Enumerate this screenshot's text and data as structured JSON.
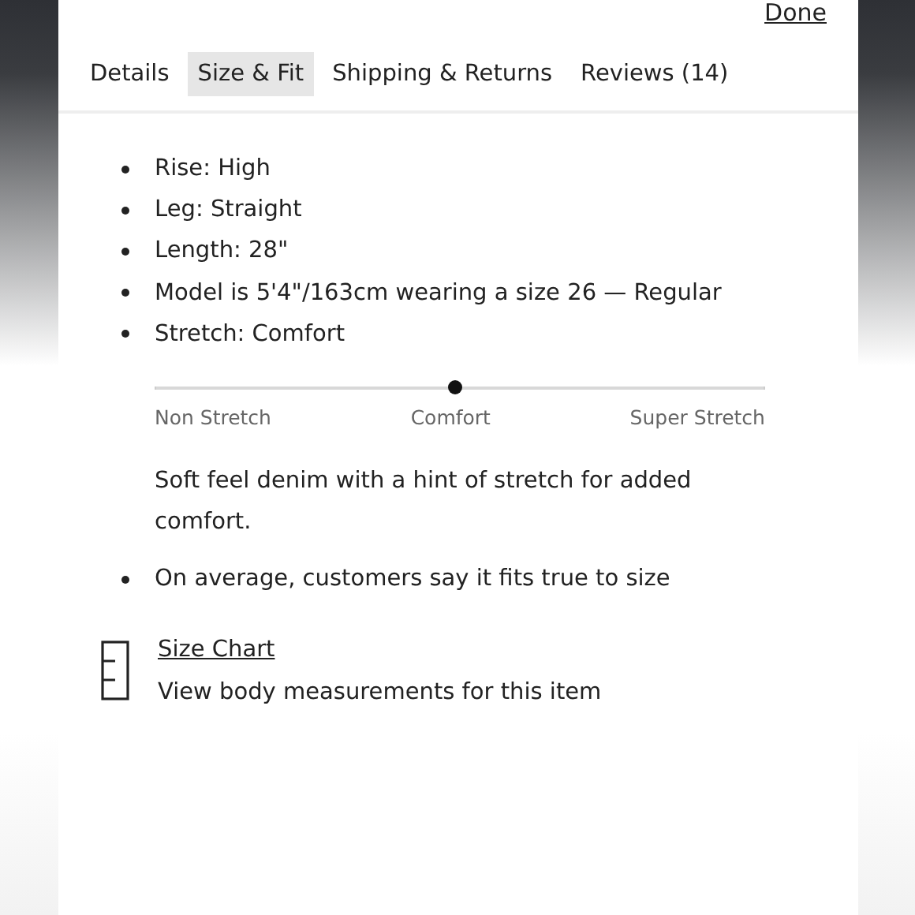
{
  "done_link": "Done",
  "tabs": [
    {
      "label": "Details",
      "selected": false
    },
    {
      "label": "Size & Fit",
      "selected": true
    },
    {
      "label": "Shipping & Returns",
      "selected": false
    },
    {
      "label": "Reviews (14)",
      "selected": false
    }
  ],
  "fit_details": [
    "Rise: High",
    "Leg: Straight",
    "Length: 28\"",
    "Model is 5'4\"/163cm wearing a size 26  —  Regular",
    "Stretch: Comfort"
  ],
  "stretch_scale": {
    "level": 0.49,
    "labels": [
      "Non Stretch",
      "Comfort",
      "Super Stretch"
    ]
  },
  "stretch_description": "Soft feel denim with a hint of stretch for added comfort.",
  "fit_notes": [
    "On average, customers say it fits true to size"
  ],
  "size_chart": {
    "link": "Size Chart",
    "description": "View body measurements for this item"
  }
}
